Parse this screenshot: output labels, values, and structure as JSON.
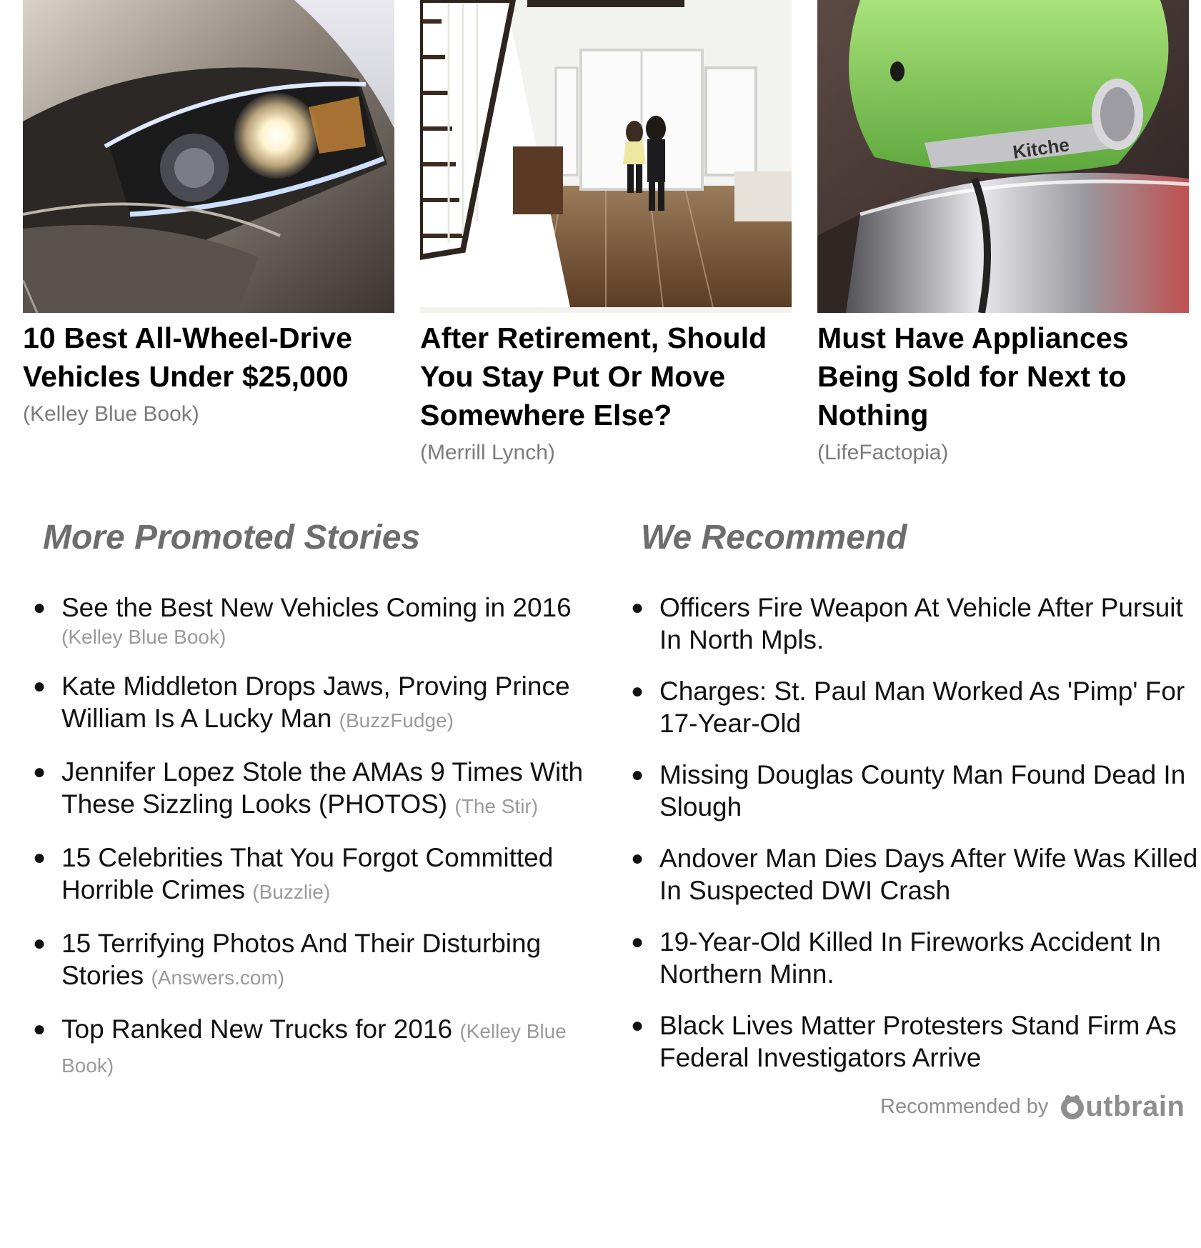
{
  "cards": [
    {
      "title": "10 Best All-Wheel-Drive Vehicles Under $25,000",
      "source": "(Kelley Blue Book)",
      "image": "car-headlight-photo"
    },
    {
      "title": "After Retirement, Should You Stay Put Or Move Somewhere Else?",
      "source": "(Merrill Lynch)",
      "image": "couple-in-house-photo"
    },
    {
      "title": "Must Have Appliances Being Sold for Next to Nothing",
      "source": "(LifeFactopia)",
      "image": "stand-mixer-photo",
      "image_text": "Kitche"
    }
  ],
  "promoted": {
    "heading": "More Promoted Stories",
    "items": [
      {
        "title": "See the Best New Vehicles Coming in 2016",
        "source": "(Kelley Blue Book)"
      },
      {
        "title": "Kate Middleton Drops Jaws, Proving Prince William Is A Lucky Man",
        "source": "(BuzzFudge)"
      },
      {
        "title": "Jennifer Lopez Stole the AMAs 9 Times With These Sizzling Looks (PHOTOS)",
        "source": "(The Stir)"
      },
      {
        "title": "15 Celebrities That You Forgot Committed Horrible Crimes",
        "source": "(Buzzlie)"
      },
      {
        "title": "15 Terrifying Photos And Their Disturbing Stories",
        "source": "(Answers.com)"
      },
      {
        "title": "Top Ranked New Trucks for 2016",
        "source": "(Kelley Blue Book)"
      }
    ]
  },
  "recommend": {
    "heading": "We Recommend",
    "items": [
      {
        "title": "Officers Fire Weapon At Vehicle After Pursuit In North Mpls."
      },
      {
        "title": "Charges: St. Paul Man Worked As 'Pimp' For 17-Year-Old"
      },
      {
        "title": "Missing Douglas County Man Found Dead In Slough"
      },
      {
        "title": "Andover Man Dies Days After Wife Was Killed In Suspected DWI Crash"
      },
      {
        "title": "19-Year-Old Killed In Fireworks Accident In Northern Minn."
      },
      {
        "title": "Black Lives Matter Protesters Stand Firm As Federal Investigators Arrive"
      }
    ]
  },
  "attribution": {
    "text": "Recommended by",
    "brand": "Outbrain"
  },
  "colors": {
    "heading": "#6d6d6d",
    "source": "#9a9a9a",
    "card_source": "#7b7b7b",
    "text": "#111111",
    "logo": "#8e8e8e"
  }
}
